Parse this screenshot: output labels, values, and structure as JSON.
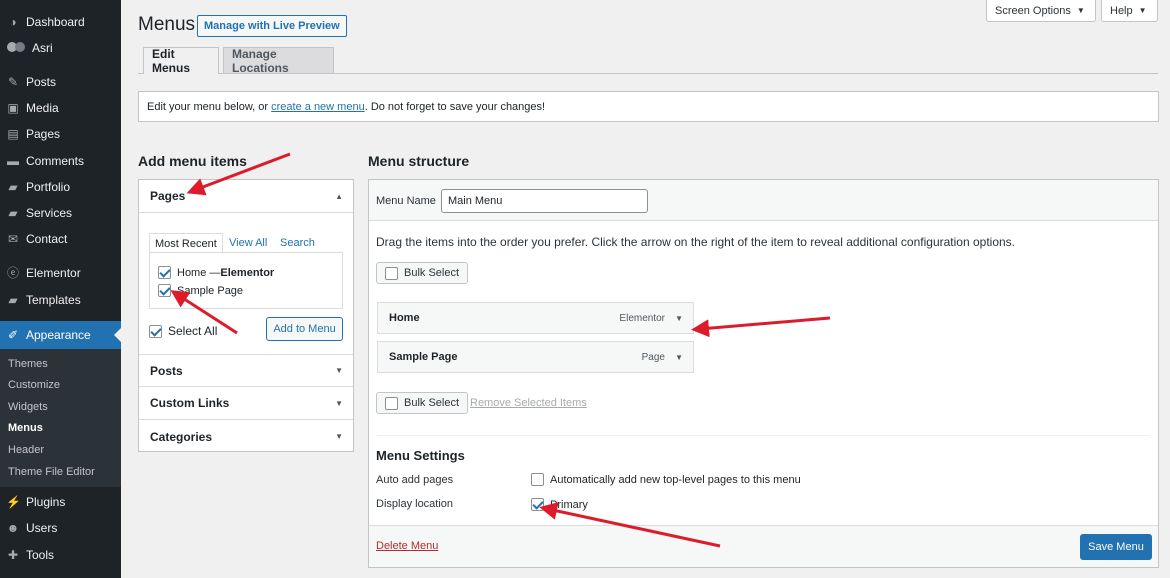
{
  "sidebar": {
    "items": [
      {
        "label": "Dashboard",
        "icon": "dashboard-icon",
        "glyph": "◑"
      },
      {
        "label": "Asri",
        "icon": "asri-icon",
        "glyph": "●"
      },
      {
        "label": "Posts",
        "icon": "pin-icon",
        "glyph": "✎"
      },
      {
        "label": "Media",
        "icon": "media-icon",
        "glyph": "▣"
      },
      {
        "label": "Pages",
        "icon": "pages-icon",
        "glyph": "▤"
      },
      {
        "label": "Comments",
        "icon": "comment-icon",
        "glyph": "▬"
      },
      {
        "label": "Portfolio",
        "icon": "portfolio-icon",
        "glyph": "▰"
      },
      {
        "label": "Services",
        "icon": "services-icon",
        "glyph": "▰"
      },
      {
        "label": "Contact",
        "icon": "contact-icon",
        "glyph": "✉"
      },
      {
        "label": "Elementor",
        "icon": "elementor-icon",
        "glyph": "ⓔ"
      },
      {
        "label": "Templates",
        "icon": "templates-icon",
        "glyph": "▰"
      },
      {
        "label": "Appearance",
        "icon": "appearance-icon",
        "glyph": "✐"
      },
      {
        "label": "Plugins",
        "icon": "plugins-icon",
        "glyph": "⚡"
      },
      {
        "label": "Users",
        "icon": "users-icon",
        "glyph": "☻"
      },
      {
        "label": "Tools",
        "icon": "tools-icon",
        "glyph": "✚"
      }
    ],
    "submenu": [
      "Themes",
      "Customize",
      "Widgets",
      "Menus",
      "Header",
      "Theme File Editor"
    ]
  },
  "header": {
    "title": "Menus",
    "live_preview": "Manage with Live Preview",
    "screen_options": "Screen Options",
    "help": "Help",
    "tabs": [
      "Edit Menus",
      "Manage Locations"
    ]
  },
  "notice": {
    "before": "Edit your menu below, or",
    "link": "create a new menu",
    "after": ". Do not forget to save your changes!"
  },
  "add_items": {
    "heading": "Add menu items",
    "pages_label": "Pages",
    "inner_tabs": [
      "Most Recent",
      "View All",
      "Search"
    ],
    "page_items": [
      {
        "prefix": "Home — ",
        "strong": "Elementor",
        "checked": true
      },
      {
        "prefix": "Sample Page",
        "strong": "",
        "checked": true
      }
    ],
    "select_all": "Select All",
    "add_button": "Add to Menu",
    "sections": [
      "Posts",
      "Custom Links",
      "Categories"
    ]
  },
  "structure": {
    "heading": "Menu structure",
    "menu_name_label": "Menu Name",
    "menu_name_value": "Main Menu",
    "instructions": "Drag the items into the order you prefer. Click the arrow on the right of the item to reveal additional configuration options.",
    "bulk_select": "Bulk Select",
    "items": [
      {
        "title": "Home",
        "type": "Elementor"
      },
      {
        "title": "Sample Page",
        "type": "Page"
      }
    ],
    "remove_selected": "Remove Selected Items",
    "settings_heading": "Menu Settings",
    "auto_add_label": "Auto add pages",
    "auto_add_text": "Automatically add new top-level pages to this menu",
    "display_location_label": "Display location",
    "primary_label": "Primary",
    "delete_menu": "Delete Menu",
    "save_menu": "Save Menu"
  },
  "colors": {
    "sidebar_bg": "#1d2327",
    "accent": "#2271b1",
    "annotation_arrow": "#dd1c2b",
    "danger": "#b32d2e"
  }
}
